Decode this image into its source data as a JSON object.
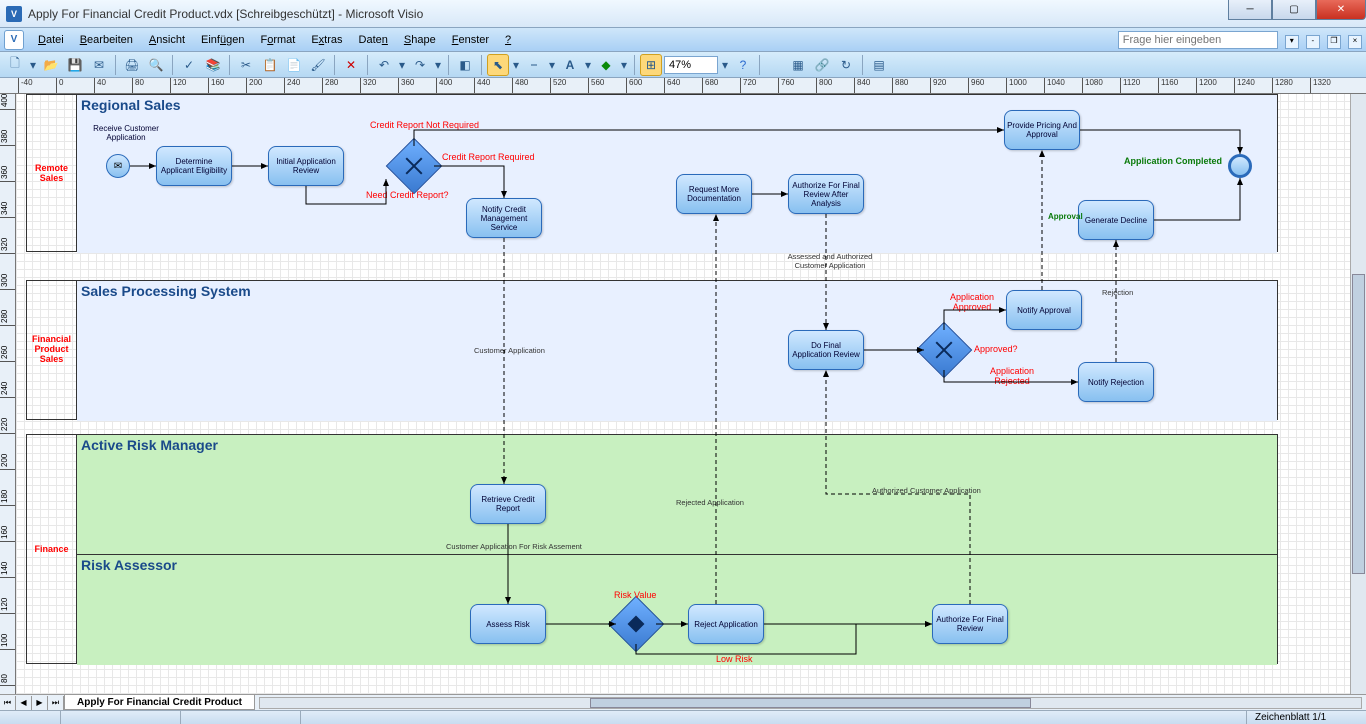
{
  "window": {
    "title": "Apply For Financial Credit Product.vdx  [Schreibgeschützt] - Microsoft Visio"
  },
  "menu": {
    "items": [
      "Datei",
      "Bearbeiten",
      "Ansicht",
      "Einfügen",
      "Format",
      "Extras",
      "Daten",
      "Shape",
      "Fenster",
      "?"
    ],
    "help_placeholder": "Frage hier eingeben"
  },
  "toolbar": {
    "zoom": "47%"
  },
  "ruler_h": [
    -40,
    0,
    40,
    80,
    120,
    160,
    200,
    240,
    280,
    320,
    360,
    400,
    440,
    480,
    520,
    560,
    600,
    640,
    680,
    720,
    760,
    800,
    840,
    880,
    920,
    960,
    1000,
    1040,
    1080,
    1120,
    1160,
    1200,
    1240,
    1280,
    1320
  ],
  "ruler_v": [
    400,
    380,
    360,
    340,
    320,
    300,
    280,
    260,
    240,
    220,
    200,
    180,
    160,
    140,
    120,
    100,
    80
  ],
  "pools": {
    "p1": {
      "header": "Remote Sales"
    },
    "p2": {
      "header": "Financial Product Sales"
    },
    "p3": {
      "header": "Finance"
    }
  },
  "lanes": {
    "l1": {
      "title": "Regional Sales"
    },
    "l2": {
      "title": "Sales Processing System"
    },
    "l3": {
      "title": "Active Risk Manager"
    },
    "l4": {
      "title": "Risk Assessor"
    }
  },
  "tasks": {
    "t1": "Determine Applicant Eligibility",
    "t2": "Initial Application Review",
    "t3": "Notify Credit Management Service",
    "t4": "Request More Documentation",
    "t5": "Authorize For Final Review After Analysis",
    "t6": "Provide Pricing And Approval",
    "t7": "Generate Decline",
    "t8": "Do Final Application Review",
    "t9": "Notify Approval",
    "t10": "Notify Rejection",
    "t11": "Retrieve Credit Report",
    "t12": "Assess Risk",
    "t13": "Reject Application",
    "t14": "Authorize For Final Review"
  },
  "labels": {
    "receive": "Receive Customer Application",
    "need_report": "Need Credit Report?",
    "not_required": "Credit Report Not Required",
    "required": "Credit Report Required",
    "assessed": "Assessed and Authorized Customer Application",
    "approved_q": "Approved?",
    "app_approved": "Application Approved",
    "app_rejected": "Application Rejected",
    "rejection": "Rejection",
    "approval": "Approval",
    "complete": "Application Completed",
    "cust_app": "Customer Application",
    "cust_app_risk": "Customer Application For Risk Assement",
    "rejected_app": "Rejected Application",
    "auth_cust": "Authorized Customer Application",
    "risk_value": "Risk Value",
    "low_risk": "Low Risk"
  },
  "sheet": {
    "tab": "Apply For Financial Credit Product"
  },
  "status": {
    "page": "Zeichenblatt 1/1"
  }
}
